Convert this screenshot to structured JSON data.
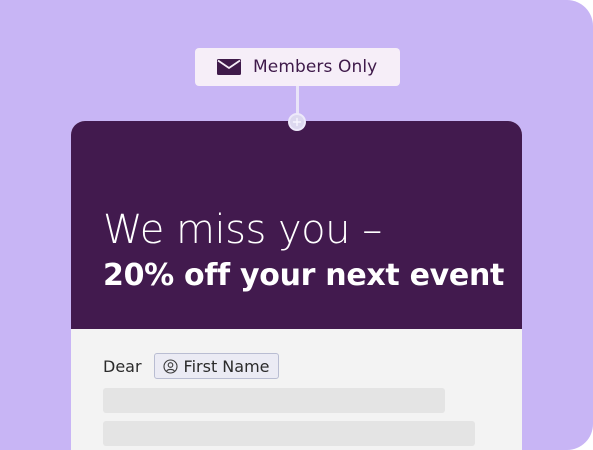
{
  "tag": {
    "icon": "envelope-icon",
    "label": "Members Only"
  },
  "hero": {
    "headline": "We miss you –",
    "subheadline": "20% off your next event"
  },
  "greeting": {
    "prefix": "Dear",
    "merge_field": {
      "icon": "user-icon",
      "label": "First Name"
    }
  },
  "colors": {
    "background": "#c8b5f5",
    "hero": "#421a4e",
    "tag_background": "#f6eef8",
    "tag_text": "#3f1a4a",
    "body": "#f3f3f3",
    "placeholder": "#e4e4e4"
  }
}
